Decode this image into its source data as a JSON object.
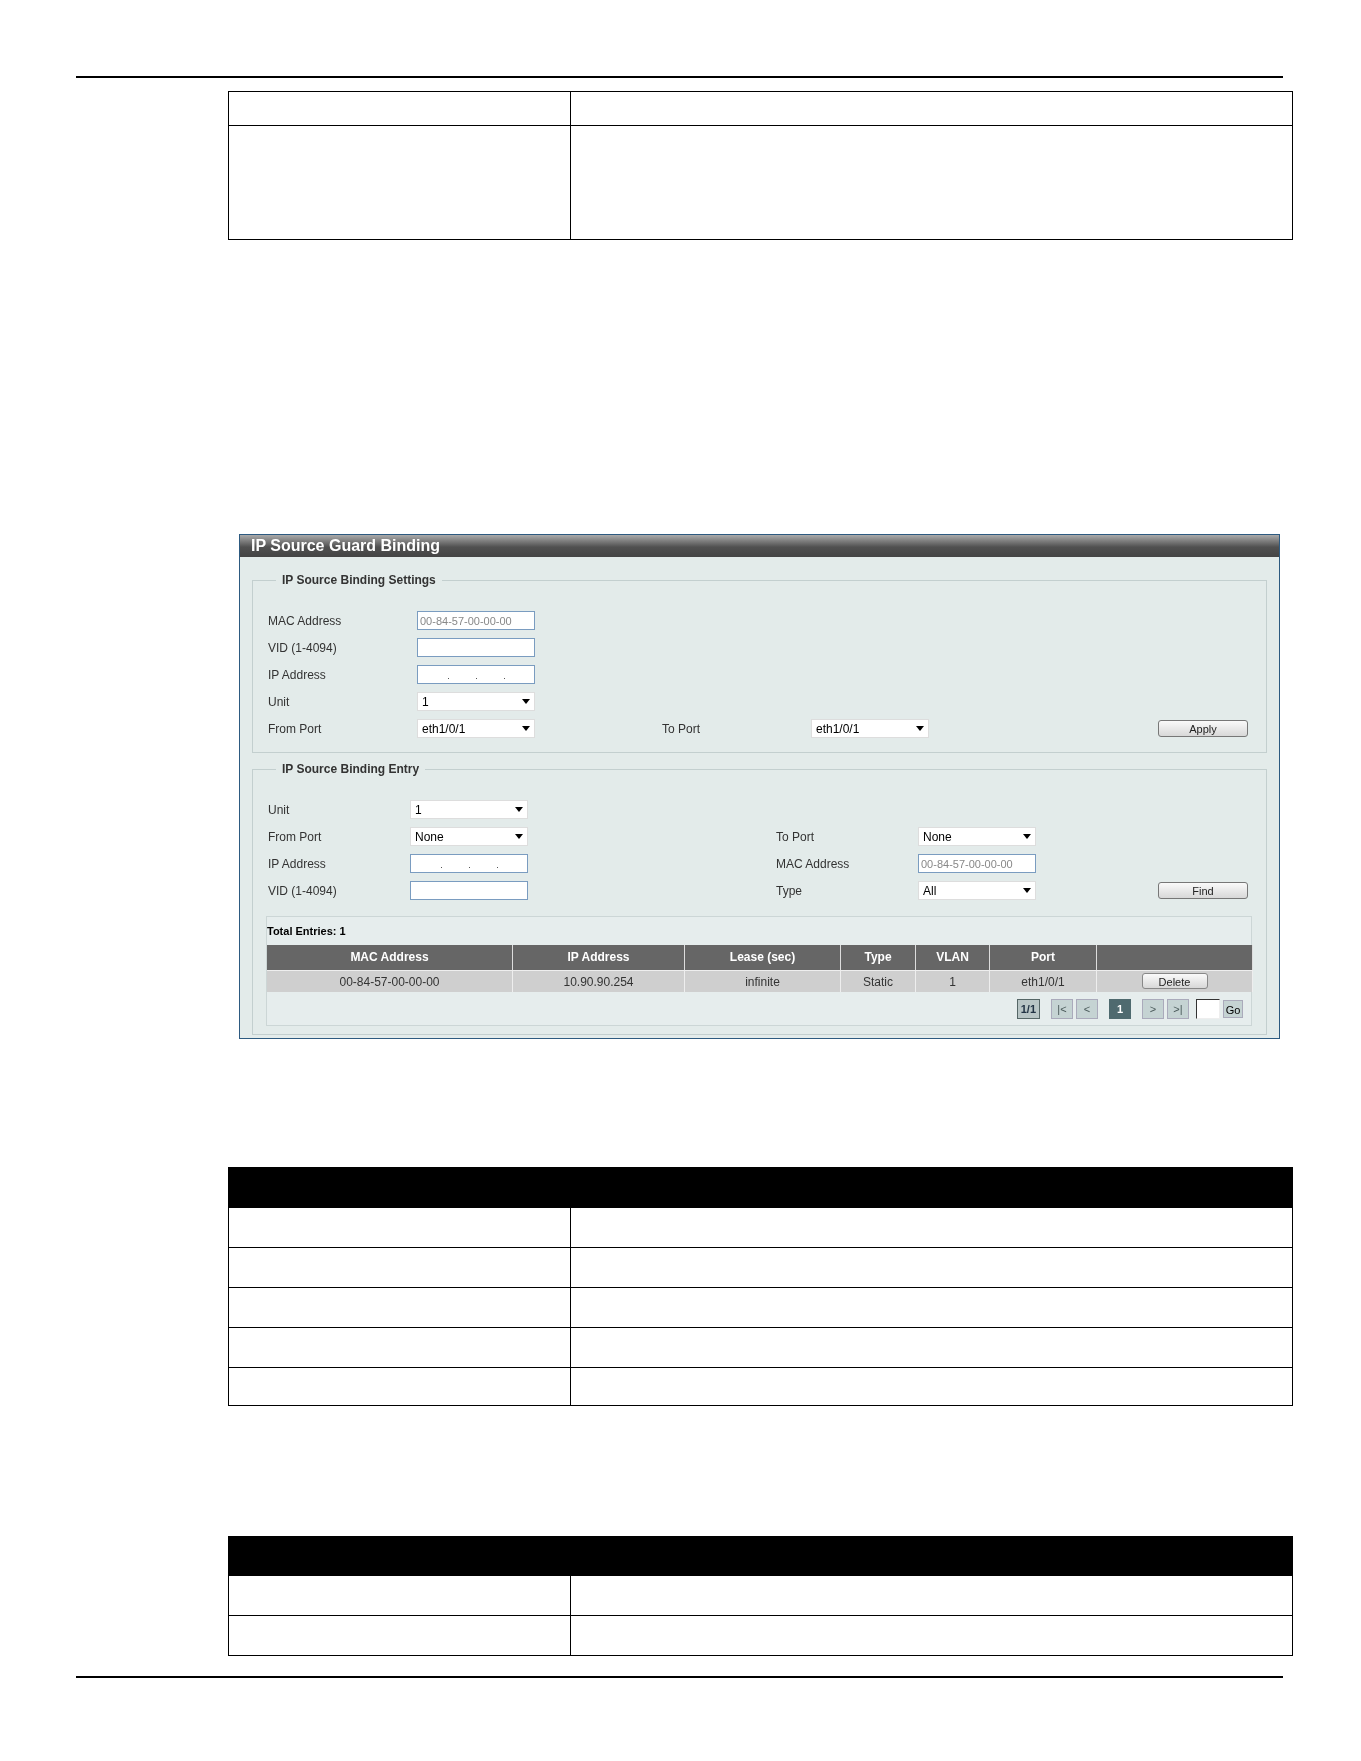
{
  "panel": {
    "title": "IP Source Guard Binding"
  },
  "settings": {
    "legend": "IP Source Binding Settings",
    "button": "Apply",
    "rows": [
      {
        "left": {
          "kind": "input",
          "label": "MAC Address",
          "placeholder": "00-84-57-00-00-00"
        }
      },
      {
        "left": {
          "kind": "input",
          "label": "VID (1-4094)"
        }
      },
      {
        "left": {
          "kind": "ip",
          "label": "IP Address"
        }
      },
      {
        "left": {
          "kind": "select",
          "label": "Unit",
          "value": "1"
        }
      },
      {
        "left": {
          "kind": "select",
          "label": "From Port",
          "value": "eth1/0/1"
        },
        "right": {
          "kind": "select",
          "label": "To Port",
          "value": "eth1/0/1"
        }
      }
    ]
  },
  "entry": {
    "legend": "IP Source Binding Entry",
    "button": "Find",
    "rows": [
      {
        "left": {
          "kind": "select",
          "label": "Unit",
          "value": "1"
        }
      },
      {
        "left": {
          "kind": "select",
          "label": "From Port",
          "value": "None"
        },
        "right": {
          "kind": "select",
          "label": "To Port",
          "value": "None"
        }
      },
      {
        "left": {
          "kind": "ip",
          "label": "IP Address"
        },
        "right": {
          "kind": "input",
          "label": "MAC Address",
          "placeholder": "00-84-57-00-00-00"
        }
      },
      {
        "left": {
          "kind": "input",
          "label": "VID (1-4094)"
        },
        "right": {
          "kind": "select",
          "label": "Type",
          "value": "All"
        }
      }
    ]
  },
  "results": {
    "total": "Total Entries: 1",
    "columns": [
      "MAC Address",
      "IP Address",
      "Lease (sec)",
      "Type",
      "VLAN",
      "Port"
    ],
    "rows": [
      {
        "cells": [
          "00-84-57-00-00-00",
          "10.90.90.254",
          "infinite",
          "Static",
          "1",
          "eth1/0/1"
        ],
        "action": "Delete"
      }
    ],
    "pagination": {
      "page_info": "1/1",
      "back": [
        {
          "label": "|<",
          "disabled": true
        },
        {
          "label": "<",
          "disabled": true
        }
      ],
      "pages": [
        {
          "label": "1",
          "selected": true
        }
      ],
      "forward": [
        {
          "label": ">",
          "disabled": true
        },
        {
          "label": ">|",
          "disabled": true
        }
      ],
      "go": "Go"
    }
  }
}
